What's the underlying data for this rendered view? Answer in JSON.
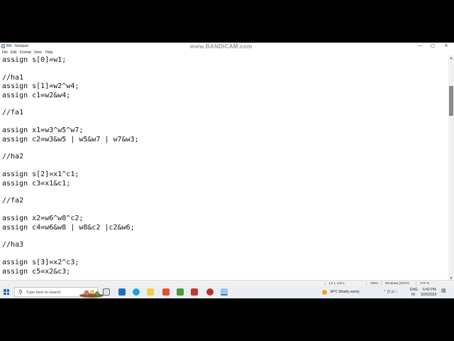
{
  "window": {
    "title": "BM - Notepad",
    "controls": {
      "minimize": "—",
      "maximize": "▢",
      "close": "✕"
    }
  },
  "watermark": "www.BANDICAM.com",
  "menu": [
    "File",
    "Edit",
    "Format",
    "View",
    "Help"
  ],
  "editor": {
    "lines": [
      "assign s[0]=w1;",
      "",
      "//ha1",
      "assign s[1]=w2^w4;",
      "assign c1=w2&w4;",
      "",
      "//fa1",
      "",
      "assign x1=w3^w5^w7;",
      "assign c2=w3&w5 | w5&w7 | w7&w3;",
      "",
      "//ha2",
      "",
      "assign s[2]=x1^c1;",
      "assign c3=x1&c1;",
      "",
      "//fa2",
      "",
      "assign x2=w6^w8^c2;",
      "assign c4=w6&w8 | w8&c2 |c2&w6;",
      "",
      "//ha3",
      "",
      "assign s[3]=x2^c3;",
      "assign c5=x2&c3;"
    ]
  },
  "statusbar": {
    "position": "Ln 1, Col 1",
    "zoom": "100%",
    "line_ending": "Windows (CRLF)",
    "encoding": "UTF-8"
  },
  "taskbar": {
    "search_placeholder": "Type here to search",
    "weather": "34°C  Mostly sunny",
    "lang_top": "ENG",
    "lang_bottom": "IN",
    "time": "6:42 PM",
    "date": "3/26/2023"
  },
  "colors": {
    "accent": "#1a6ed8",
    "scroll_thumb": "#8a8a8a"
  }
}
